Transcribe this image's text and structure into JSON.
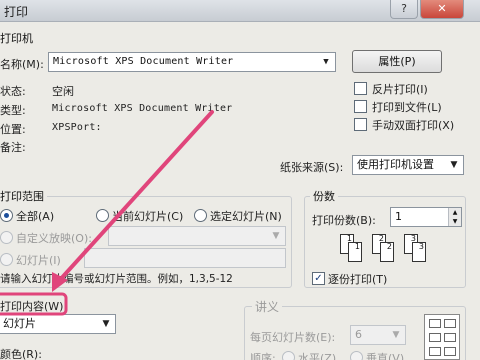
{
  "window": {
    "title": "打印",
    "close_glyph": "✕",
    "help_glyph": "?"
  },
  "printer": {
    "section_title": "打印机",
    "name_label": "名称(M):",
    "name_value": "Microsoft XPS Document Writer",
    "properties_label": "属性(P)",
    "status_label": "状态:",
    "status_value": "空闲",
    "type_label": "类型:",
    "type_value": "Microsoft XPS Document Writer",
    "where_label": "位置:",
    "where_value": "XPSPort:",
    "comment_label": "备注:",
    "options": [
      {
        "label": "反片打印(I)",
        "checked": false
      },
      {
        "label": "打印到文件(L)",
        "checked": false
      },
      {
        "label": "手动双面打印(X)",
        "checked": false
      }
    ],
    "paper_source_label": "纸张来源(S):",
    "paper_source_value": "使用打印机设置"
  },
  "range": {
    "section_title": "打印范围",
    "all_label": "全部(A)",
    "current_label": "当前幻灯片(C)",
    "selection_label": "选定幻灯片(N)",
    "custom_label": "自定义放映(O):",
    "slides_label": "幻灯片(I)",
    "hint": "请输入幻灯片编号或幻灯片范围。例如，1,3,5-12"
  },
  "copies": {
    "section_title": "份数",
    "count_label": "打印份数(B):",
    "count_value": "1",
    "collate_label": "逐份打印(T)",
    "collate_checked": true,
    "page_numbers": [
      "1",
      "1",
      "2",
      "2",
      "3",
      "3"
    ]
  },
  "print_what": {
    "label": "打印内容(W):",
    "value": "幻灯片"
  },
  "color": {
    "label": "颜色(R):"
  },
  "handouts": {
    "section_title": "讲义",
    "per_page_label": "每页幻灯片数(E):",
    "per_page_value": "6",
    "order_label": "顺序:",
    "horizontal_label": "水平(Z)",
    "vertical_label": "垂直(V)"
  },
  "annotation": {
    "color": "#e0457b"
  }
}
